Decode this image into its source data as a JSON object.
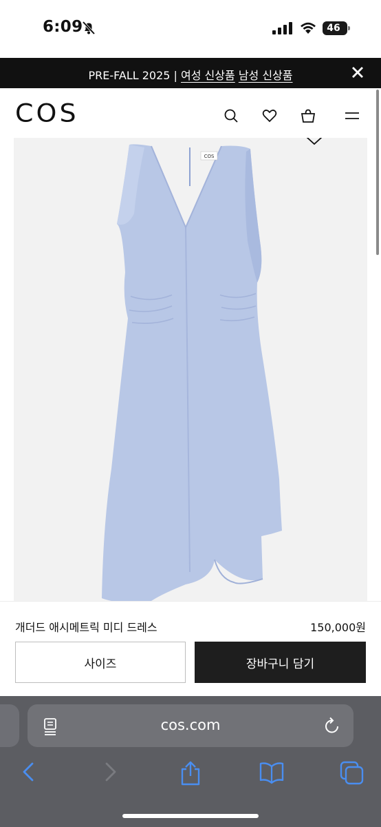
{
  "status_bar": {
    "time": "6:09",
    "battery": "46"
  },
  "promo": {
    "prefix": "PRE-FALL 2025 | ",
    "women_link": "여성 신상품",
    "men_link": "남성 신상품"
  },
  "header": {
    "logo": "COS"
  },
  "product": {
    "name": "개더드 애시메트릭 미디 드레스",
    "price": "150,000원",
    "label_tag": "COS"
  },
  "actions": {
    "size_label": "사이즈",
    "cart_label": "장바구니 담기"
  },
  "browser": {
    "url": "cos.com"
  },
  "colors": {
    "dress": "#b8c7e6",
    "banner": "#111111",
    "primary_button": "#1e1e1e",
    "safari_bar": "#5c5d62",
    "link_blue": "#4a8ef0"
  },
  "icons": [
    "bell-slash-icon",
    "signal-icon",
    "wifi-icon",
    "battery-icon",
    "close-icon",
    "search-icon",
    "heart-icon",
    "bag-icon",
    "menu-icon",
    "chevron-down-icon",
    "reader-icon",
    "reload-icon",
    "back-icon",
    "forward-icon",
    "share-icon",
    "bookmarks-icon",
    "tabs-icon"
  ]
}
